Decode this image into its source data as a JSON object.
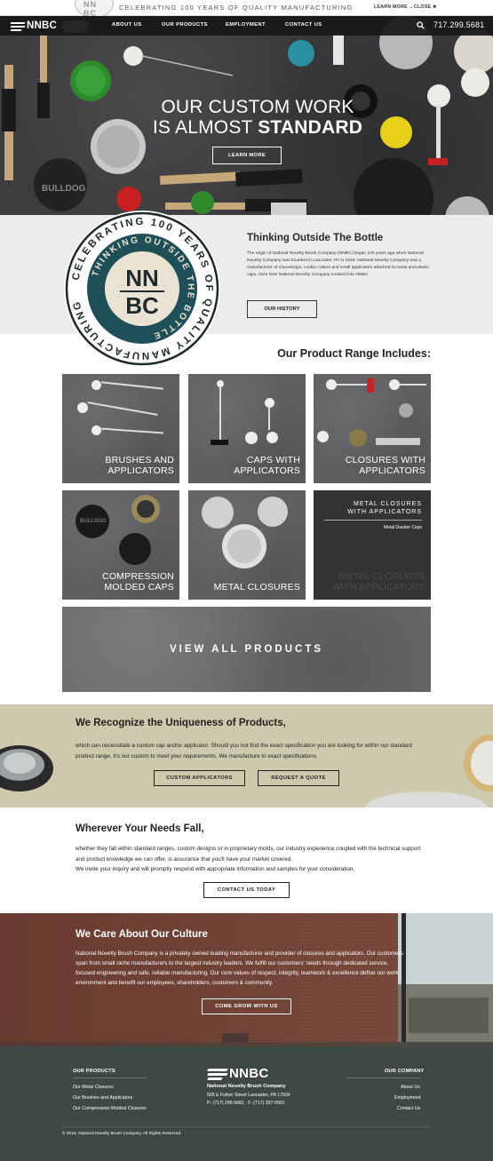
{
  "announce": {
    "seal_text": "NN BC",
    "message": "CELEBRATING 100 YEARS OF QUALITY MANUFACTURING",
    "learn_more": "LEARN MORE",
    "close": "CLOSE"
  },
  "nav": {
    "logo": "NNBC",
    "items": [
      "ABOUT US",
      "OUR PRODUCTS",
      "EMPLOYMENT",
      "CONTACT US"
    ],
    "phone": "717.299.5681"
  },
  "hero": {
    "line1": "OUR CUSTOM WORK",
    "line2_regular": "IS ALMOST ",
    "line2_bold": "STANDARD",
    "button": "LEARN MORE",
    "jar_label": "BULLDOG"
  },
  "badge": {
    "outer_text": "CELEBRATING 100 YEARS OF QUALITY MANUFACTURING",
    "inner_text": "THINKING OUTSIDE THE BOTTLE",
    "monogram_top": "NN",
    "monogram_bottom": "BC"
  },
  "thinking": {
    "title": "Thinking Outside The Bottle",
    "body": "The origin of National Novelty Brush Company (NNBC) began 100 years ago when National Novelty Company was founded in Lancaster, PA in 1916. National Novelty Company was a manufacturer of mousetraps, cookie cutters and small applicators attached to metal and plastic caps. Over time National Novelty Company evolved into NNBC.",
    "button": "OUR HISTORY"
  },
  "range": {
    "heading": "Our Product Range Includes:",
    "tiles": [
      {
        "line1": "BRUSHES AND",
        "line2": "APPLICATORS"
      },
      {
        "line1": "CAPS WITH",
        "line2": "APPLICATORS"
      },
      {
        "line1": "CLOSURES WITH",
        "line2": "APPLICATORS"
      },
      {
        "line1": "COMPRESSION",
        "line2": "MOLDED CAPS"
      },
      {
        "line1": "METAL CLOSURES",
        "line2": ""
      },
      {
        "line1": "METAL CLOSURES",
        "line2": "WITH APPLICATORS"
      }
    ],
    "hover_tile": {
      "top1": "METAL CLOSURES",
      "top2": "WITH APPLICATORS",
      "sub": "Metal Dauber Caps"
    },
    "compression_cap_label": "BULLDOG",
    "view_all": "VIEW ALL PRODUCTS"
  },
  "recognize": {
    "title": "We Recognize the Uniqueness of Products,",
    "body": "which can necessitate a custom cap and/or applicator. Should you not find the exact specification you are looking for within our standard product range, it's our custom to meet your requirements. We manufacture to exact specifications.",
    "btn_custom": "CUSTOM APPLICATORS",
    "btn_quote": "REQUEST A QUOTE"
  },
  "wherever": {
    "title": "Wherever Your Needs Fall,",
    "body1": "whether they fall within standard ranges, custom designs or in proprietary molds, our industry experience coupled with the technical support and product knowledge we can offer, is assurance that you'll have your market covered.",
    "body2": "We invite your inquiry and will promptly respond with appropriate information and samples for your consideration.",
    "button": "CONTACT US TODAY"
  },
  "culture": {
    "title": "We Care About Our Culture",
    "body": "National Novelty Brush Company is a privately owned leading manufacturer and provider of closures and applicators. Our customers span from small niche manufacturers to the largest industry leaders. We fulfill our customers' needs through dedicated service, focused engineering and safe, reliable manufacturing. Our core values of respect, integrity, teamwork & excellence define our work environment and benefit our employees, shareholders, customers & community.",
    "button": "COME GROW WITH US"
  },
  "footer": {
    "products_heading": "OUR PRODUCTS",
    "products_links": [
      "Our Metal Closures",
      "Our Brushes and Applicators",
      "Our Compression Molded Closures"
    ],
    "logo": "NNBC",
    "company_name": "National Novelty Brush Company",
    "address": "505 E Fulton Street Lancaster, PA 17604",
    "phone": "P: (717) 299-5681",
    "fax": "F: (717) 397-0991",
    "company_heading": "OUR COMPANY",
    "company_links": [
      "About Us",
      "Employment",
      "Contact Us"
    ],
    "copyright": "© 2016, National Novelty Brush Company. All Rights Reserved."
  },
  "colors": {
    "badge_teal": "#1f4f57",
    "recognize_bg": "#ccc9ad",
    "footer_bg": "#3e4847"
  }
}
